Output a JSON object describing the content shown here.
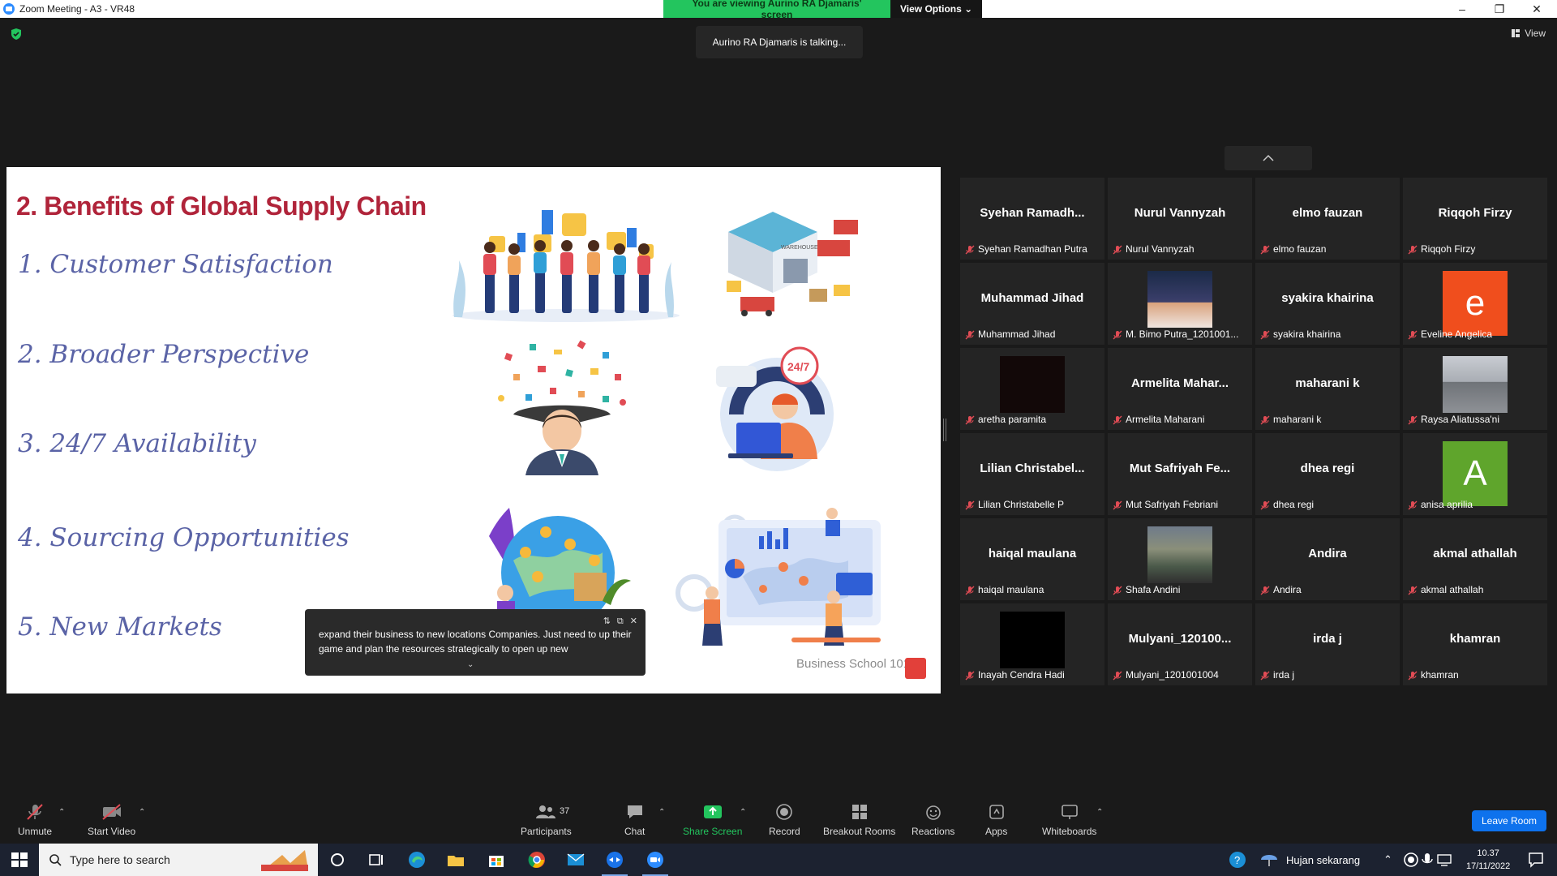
{
  "window": {
    "title": "Zoom Meeting - A3 - VR48",
    "banner": "You are viewing Aurino RA Djamaris' screen",
    "view_options": "View Options"
  },
  "meeting": {
    "talking": "Aurino RA Djamaris is talking...",
    "view_label": "View"
  },
  "slide": {
    "title": "2. Benefits of Global Supply Chain",
    "benefits": [
      "1. Customer Satisfaction",
      "2. Broader Perspective",
      "3. 24/7 Availability",
      "4. Sourcing Opportunities",
      "5. New Markets"
    ],
    "badge_247": "24/7",
    "warehouse_sign": "WAREHOUSE",
    "brand": "Business School 101",
    "caption": "expand their business to new locations Companies. Just need to up their game and plan the resources strategically to open up new"
  },
  "participants": [
    {
      "big": "Syehan  Ramadh...",
      "name": "Syehan Ramadhan Putra",
      "type": "name"
    },
    {
      "big": "Nurul Vannyzah",
      "name": "Nurul Vannyzah",
      "type": "name"
    },
    {
      "big": "elmo fauzan",
      "name": "elmo fauzan",
      "type": "name"
    },
    {
      "big": "Riqqoh Firzy",
      "name": "Riqqoh Firzy",
      "type": "name"
    },
    {
      "big": "Muhammad Jihad",
      "name": "Muhammad Jihad",
      "type": "name"
    },
    {
      "big": "",
      "name": "M. Bimo Putra_1201001...",
      "type": "photo-night"
    },
    {
      "big": "syakira khairina",
      "name": "syakira khairina",
      "type": "name"
    },
    {
      "big": "e",
      "name": "Eveline Angelica",
      "type": "avatar",
      "color": "#f04e1d"
    },
    {
      "big": "",
      "name": "aretha paramita",
      "type": "dark"
    },
    {
      "big": "Armelita  Mahar...",
      "name": "Armelita Maharani",
      "type": "name"
    },
    {
      "big": "maharani k",
      "name": "maharani k",
      "type": "name"
    },
    {
      "big": "",
      "name": "Raysa Aliatussa'ni",
      "type": "photo-river"
    },
    {
      "big": "Lilian  Christabel...",
      "name": "Lilian Christabelle P",
      "type": "name"
    },
    {
      "big": "Mut  Safriyah  Fe...",
      "name": "Mut Safriyah Febriani",
      "type": "name"
    },
    {
      "big": "dhea regi",
      "name": "dhea regi",
      "type": "name"
    },
    {
      "big": "A",
      "name": "anisa aprilia",
      "type": "avatar",
      "color": "#5fa52c"
    },
    {
      "big": "haiqal maulana",
      "name": "haiqal maulana",
      "type": "name"
    },
    {
      "big": "",
      "name": "Shafa Andini",
      "type": "photo-building"
    },
    {
      "big": "Andira",
      "name": "Andira",
      "type": "name"
    },
    {
      "big": "akmal athallah",
      "name": "akmal athallah",
      "type": "name"
    },
    {
      "big": "",
      "name": "Inayah Cendra Hadi",
      "type": "black"
    },
    {
      "big": "Mulyani_120100...",
      "name": "Mulyani_1201001004",
      "type": "name"
    },
    {
      "big": "irda j",
      "name": "irda j",
      "type": "name"
    },
    {
      "big": "khamran",
      "name": "khamran",
      "type": "name"
    }
  ],
  "toolbar": {
    "unmute": "Unmute",
    "start_video": "Start Video",
    "participants": "Participants",
    "participants_count": "37",
    "chat": "Chat",
    "share_screen": "Share Screen",
    "record": "Record",
    "breakout_rooms": "Breakout Rooms",
    "reactions": "Reactions",
    "apps": "Apps",
    "whiteboards": "Whiteboards",
    "leave_room": "Leave Room"
  },
  "taskbar": {
    "search_placeholder": "Type here to search",
    "weather": "Hujan sekarang",
    "time": "10.37",
    "date": "17/11/2022"
  },
  "colors": {
    "share_green": "#23c55e",
    "leave_blue": "#0e72ed",
    "slide_title": "#b0243a",
    "benefit_text": "#5a63a6"
  }
}
